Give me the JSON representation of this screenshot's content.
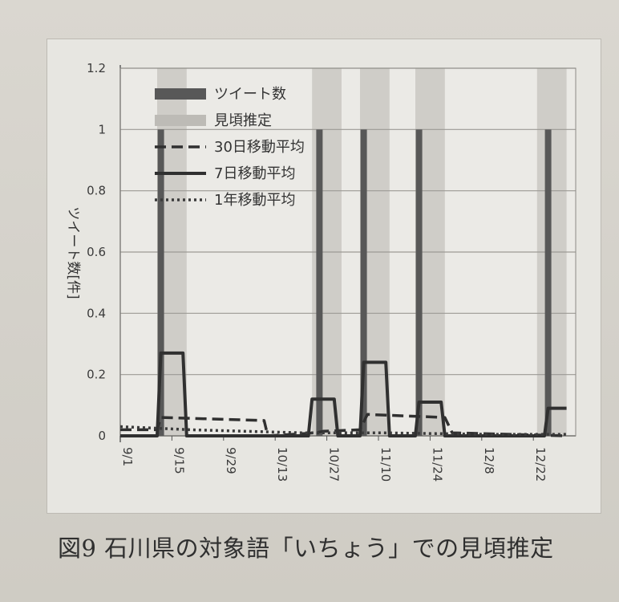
{
  "caption": "図9 石川県の対象語「いちょう」での見頃推定",
  "chart_data": {
    "type": "line",
    "ylabel": "ツイート数[件]",
    "ylim": [
      0,
      1.2
    ],
    "yticks": [
      "0",
      "0.2",
      "0.4",
      "0.6",
      "0.8",
      "1",
      "1.2"
    ],
    "xticks": [
      "9/1",
      "9/15",
      "9/29",
      "10/13",
      "10/27",
      "11/10",
      "11/24",
      "12/8",
      "12/22"
    ],
    "grid": true,
    "legend_position": "top-left",
    "legend": [
      {
        "label": "ツイート数",
        "style": "bar"
      },
      {
        "label": "見頃推定",
        "style": "shade"
      },
      {
        "label": "30日移動平均",
        "style": "dashed"
      },
      {
        "label": "7日移動平均",
        "style": "solid"
      },
      {
        "label": "1年移動平均",
        "style": "dotted"
      }
    ],
    "shaded_ranges": [
      [
        "9/11",
        "9/19"
      ],
      [
        "10/23",
        "10/31"
      ],
      [
        "11/5",
        "11/13"
      ],
      [
        "11/20",
        "11/28"
      ],
      [
        "12/23",
        "12/31"
      ]
    ],
    "tweet_bars": [
      {
        "date": "9/12",
        "value": 1
      },
      {
        "date": "10/25",
        "value": 1
      },
      {
        "date": "11/6",
        "value": 1
      },
      {
        "date": "11/21",
        "value": 1
      },
      {
        "date": "12/26",
        "value": 1
      }
    ],
    "series": [
      {
        "name": "7日移動平均",
        "style": "solid",
        "points": [
          [
            "9/1",
            0
          ],
          [
            "9/11",
            0
          ],
          [
            "9/12",
            0.27
          ],
          [
            "9/18",
            0.27
          ],
          [
            "9/19",
            0
          ],
          [
            "10/22",
            0
          ],
          [
            "10/23",
            0.12
          ],
          [
            "10/29",
            0.12
          ],
          [
            "10/30",
            0
          ],
          [
            "11/5",
            0
          ],
          [
            "11/6",
            0.24
          ],
          [
            "11/12",
            0.24
          ],
          [
            "11/13",
            0
          ],
          [
            "11/20",
            0
          ],
          [
            "11/21",
            0.11
          ],
          [
            "11/27",
            0.11
          ],
          [
            "11/28",
            0
          ],
          [
            "12/25",
            0
          ],
          [
            "12/26",
            0.09
          ],
          [
            "12/31",
            0.09
          ]
        ]
      },
      {
        "name": "30日移動平均",
        "style": "dashed",
        "points": [
          [
            "9/1",
            0.02
          ],
          [
            "9/11",
            0.02
          ],
          [
            "9/12",
            0.06
          ],
          [
            "10/10",
            0.05
          ],
          [
            "10/11",
            0
          ],
          [
            "10/24",
            0.01
          ],
          [
            "10/26",
            0.015
          ],
          [
            "11/5",
            0.02
          ],
          [
            "11/7",
            0.07
          ],
          [
            "11/28",
            0.06
          ],
          [
            "11/30",
            0.01
          ],
          [
            "12/31",
            0.0
          ]
        ]
      },
      {
        "name": "1年移動平均",
        "style": "dotted",
        "points": [
          [
            "9/1",
            0.03
          ],
          [
            "9/20",
            0.02
          ],
          [
            "10/20",
            0.01
          ],
          [
            "11/10",
            0.01
          ],
          [
            "12/10",
            0.005
          ],
          [
            "12/31",
            0.005
          ]
        ]
      }
    ]
  }
}
